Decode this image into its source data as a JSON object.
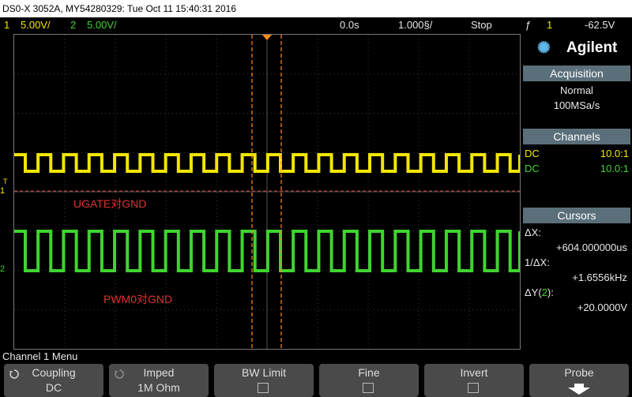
{
  "title_bar": "DS0-X 3052A, MY54280329: Tue Oct 11 15:40:31 2016",
  "status": {
    "ch1_num": "1",
    "ch1_scale": "5.00V/",
    "ch2_num": "2",
    "ch2_scale": "5.00V/",
    "time_offset": "0.0s",
    "time_scale": "1.000§/",
    "run_state": "Stop",
    "trigger_symbol": "ƒ",
    "trigger_ch": "1",
    "trigger_level": "-62.5V"
  },
  "waveform_labels": {
    "ch1_annotation": "UGATE对GND",
    "ch2_annotation": "PWM0对GND",
    "ch1_marker": "1",
    "ch2_marker": "2",
    "trigger_marker": "T"
  },
  "side_panel": {
    "brand": "Agilent",
    "acquisition": {
      "header": "Acquisition",
      "mode": "Normal",
      "rate": "100MSa/s"
    },
    "channels": {
      "header": "Channels",
      "rows": [
        {
          "coupling": "DC",
          "probe": "10.0:1",
          "color": "#f2e600"
        },
        {
          "coupling": "DC",
          "probe": "10.0:1",
          "color": "#3fd42f"
        }
      ]
    },
    "cursors": {
      "header": "Cursors",
      "dx_label": "ΔX:",
      "dx_value": "+604.000000us",
      "inv_dx_label": "1/ΔX:",
      "inv_dx_value": "+1.6556kHz",
      "dy_label": "ΔY(",
      "dy_ch": "2",
      "dy_label_end": "):",
      "dy_value": "+20.0000V"
    }
  },
  "menu_title": "Channel 1 Menu",
  "softkeys": [
    {
      "label": "Coupling",
      "value": "DC"
    },
    {
      "label": "Imped",
      "value": "1M Ohm"
    },
    {
      "label": "BW Limit",
      "value": ""
    },
    {
      "label": "Fine",
      "value": ""
    },
    {
      "label": "Invert",
      "value": ""
    },
    {
      "label": "Probe",
      "value": ""
    }
  ],
  "colors": {
    "ch1": "#f2e600",
    "ch2": "#3fd42f",
    "cursor": "#ff8c1a",
    "annotation": "#e03030"
  }
}
